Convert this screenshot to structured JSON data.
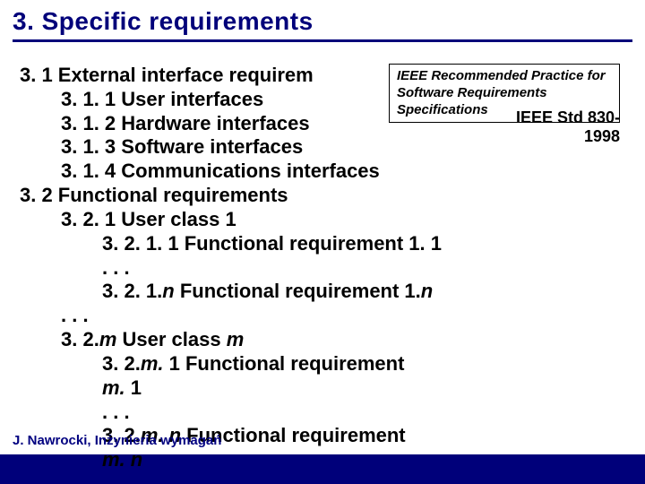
{
  "title": "3. Specific requirements",
  "lines": {
    "l31": "3. 1 External interface requirem",
    "l311": "3. 1. 1 User interfaces",
    "l312": "3. 1. 2 Hardware interfaces",
    "l313": "3. 1. 3 Software interfaces",
    "l314": "3. 1. 4 Communications interfaces",
    "l32": "3. 2 Functional requirements",
    "l321": "3. 2. 1 User class 1",
    "l3211": "3. 2. 1. 1 Functional requirement 1. 1",
    "dots1": ". . .",
    "l321n_a": "3. 2. 1.",
    "l321n_b": "n",
    "l321n_c": " Functional requirement 1.",
    "l321n_d": "n",
    "dots2": ". . .",
    "l32m_a": "3. 2.",
    "l32m_b": "m",
    "l32m_c": " User class ",
    "l32m_d": "m",
    "l32m1_a": "3. 2.",
    "l32m1_b": "m.",
    "l32m1_c": " 1 Functional requirement",
    "m1_a": "m.",
    "m1_b": " 1",
    "dots3": ". . .",
    "l32mn_a": "3. 2.",
    "l32mn_b": "m. n",
    "l32mn_c": " Functional requirement",
    "mn_a": "m. n"
  },
  "ieee_box": {
    "line1": "IEEE Recommended Practice for",
    "line2": "Software Requirements",
    "line3": "Specifications"
  },
  "ieee_std": {
    "line1": "IEEE Std 830-",
    "line2": "1998"
  },
  "footer": "J. Nawrocki, Inżynieria wymagań"
}
